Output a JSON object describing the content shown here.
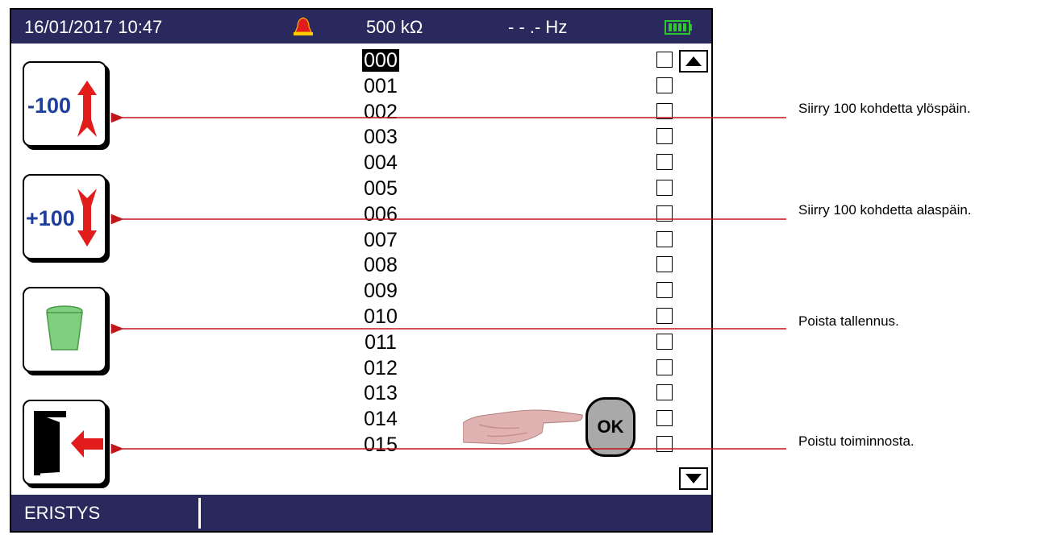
{
  "status": {
    "datetime": "16/01/2017  10:47",
    "resistance": "500  kΩ",
    "frequency": "- - .-   Hz",
    "alarm_icon": "bell-icon",
    "battery_icon": "battery-full-icon"
  },
  "buttons": {
    "up100_label": "-100",
    "down100_label": "+100",
    "delete_icon": "trash-icon",
    "exit_icon": "exit-icon",
    "ok_label": "OK"
  },
  "records": [
    "000",
    "001",
    "002",
    "003",
    "004",
    "005",
    "006",
    "007",
    "008",
    "009",
    "010",
    "011",
    "012",
    "013",
    "014",
    "015"
  ],
  "selected_record": "000",
  "footer": {
    "mode": "ERISTYS"
  },
  "callouts": {
    "up": "Siirry 100 kohdetta ylöspäin.",
    "down": "Siirry 100 kohdetta alaspäin.",
    "delete": "Poista tallennus.",
    "exit": "Poistu toiminnosta."
  },
  "colors": {
    "bar": "#29295e",
    "callout_line": "#c0161c",
    "button_blue": "#1f3f9c",
    "button_red": "#e21b1b",
    "trash_green": "#7fcf7f"
  }
}
